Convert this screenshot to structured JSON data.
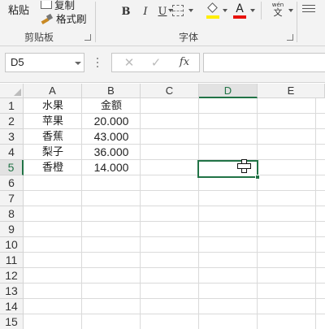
{
  "ribbon": {
    "clipboard": {
      "paste_label": "粘贴",
      "copy_label": "复制",
      "format_painter_label": "格式刷",
      "group_label": "剪贴板"
    },
    "font": {
      "bold": "B",
      "italic": "I",
      "underline": "U",
      "font_color_glyph": "A",
      "phonetic_pinyin": "wén",
      "phonetic_char": "文",
      "group_label": "字体",
      "fill_color": "#ffee00",
      "font_color": "#e8120c"
    }
  },
  "formula_bar": {
    "name_box": "D5",
    "cancel_glyph": "✕",
    "enter_glyph": "✓",
    "fx_label": "fx",
    "formula_value": ""
  },
  "sheet": {
    "columns": [
      "A",
      "B",
      "C",
      "D",
      "E"
    ],
    "rows": [
      "1",
      "2",
      "3",
      "4",
      "5",
      "6",
      "7",
      "8",
      "9",
      "10",
      "11",
      "12",
      "13",
      "14",
      "15"
    ],
    "active_column": "D",
    "active_row": "5",
    "accent_color": "#217346",
    "data": [
      [
        "水果",
        "金额"
      ],
      [
        "苹果",
        "20.000"
      ],
      [
        "香蕉",
        "43.000"
      ],
      [
        "梨子",
        "36.000"
      ],
      [
        "香橙",
        "14.000"
      ]
    ]
  }
}
